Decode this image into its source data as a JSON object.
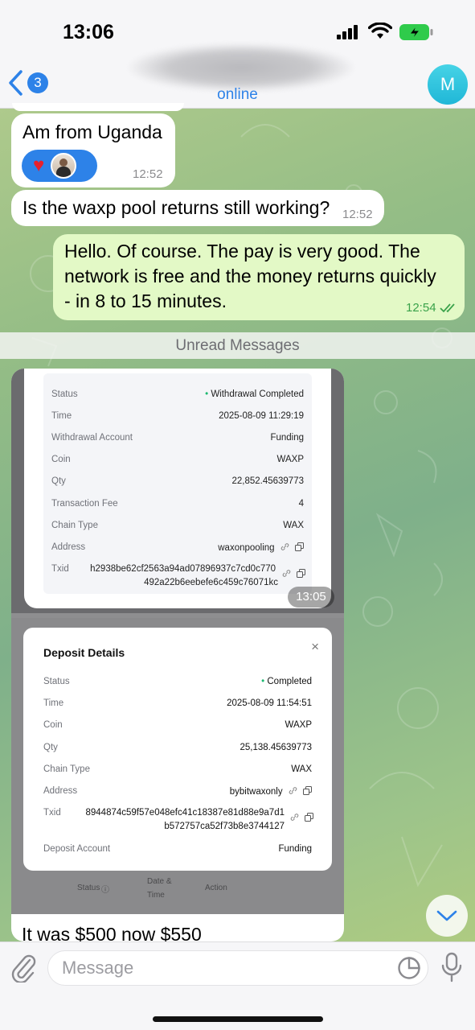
{
  "status_bar": {
    "time": "13:06"
  },
  "header": {
    "unread_count": "3",
    "status": "online",
    "avatar_letter": "M"
  },
  "messages": [
    {
      "id": "m1",
      "direction": "in",
      "text": "Am from Uganda",
      "time": "12:52",
      "reaction": "heart"
    },
    {
      "id": "m2",
      "direction": "in",
      "text": "Is the waxp pool returns still working?",
      "time": "12:52"
    },
    {
      "id": "m3",
      "direction": "out",
      "lines": [
        "Hello. Of course. The pay is very good. The",
        "network is free and the money returns quickly",
        "- in 8 to 15 minutes."
      ],
      "time": "12:54",
      "read": true
    }
  ],
  "unread_label": "Unread Messages",
  "photo_message": {
    "time": "13:05",
    "withdrawal": {
      "rows": [
        {
          "k": "Status",
          "v": "Withdrawal Completed"
        },
        {
          "k": "Time",
          "v": "2025-08-09 11:29:19"
        },
        {
          "k": "Withdrawal Account",
          "v": "Funding"
        },
        {
          "k": "Coin",
          "v": "WAXP"
        },
        {
          "k": "Qty",
          "v": "22,852.45639773"
        },
        {
          "k": "Transaction Fee",
          "v": "4"
        },
        {
          "k": "Chain Type",
          "v": "WAX"
        },
        {
          "k": "Address",
          "v": "waxonpooling"
        },
        {
          "k": "Txid",
          "v1": "h2938be62cf2563a94ad07896937c7cd0c770",
          "v2": "492a22b6eebefe6c459c76071kc"
        }
      ]
    },
    "deposit": {
      "title": "Deposit Details",
      "close": "×",
      "rows": [
        {
          "k": "Status",
          "v": "Completed"
        },
        {
          "k": "Time",
          "v": "2025-08-09 11:54:51"
        },
        {
          "k": "Coin",
          "v": "WAXP"
        },
        {
          "k": "Qty",
          "v": "25,138.45639773"
        },
        {
          "k": "Chain Type",
          "v": "WAX"
        },
        {
          "k": "Address",
          "v": "bybitwaxonly"
        },
        {
          "k": "Txid",
          "v1": "8944874c59f57e048efc41c18387e81d88e9a7d1",
          "v2": "b572757ca52f73b8e3744127"
        },
        {
          "k": "Deposit Account",
          "v": "Funding"
        }
      ],
      "table_head": {
        "status": "Status",
        "date1": "Date &",
        "date2": "Time",
        "action": "Action"
      }
    },
    "caption": "It was $500 now $550"
  },
  "composer": {
    "placeholder": "Message"
  },
  "colors": {
    "accent": "#2d82e8",
    "outgoing_bubble": "#e3f9c6",
    "read_check": "#3aa24a"
  }
}
